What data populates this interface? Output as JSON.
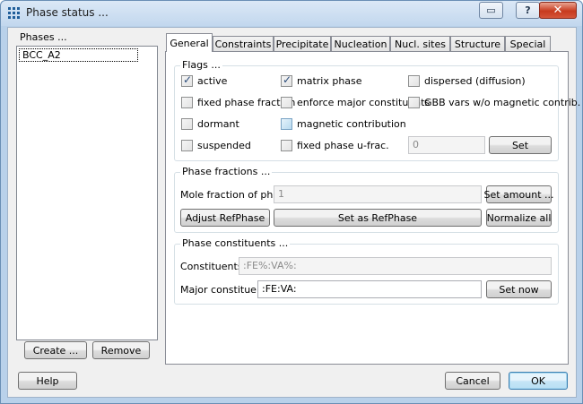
{
  "window": {
    "title": "Phase status ...",
    "help_glyph": "?",
    "close_glyph": "✕",
    "restore_glyph": "▭"
  },
  "phases": {
    "label": "Phases ...",
    "items": [
      "BCC_A2"
    ],
    "create_label": "Create ...",
    "remove_label": "Remove"
  },
  "tabs": [
    {
      "label": "General",
      "active": true
    },
    {
      "label": "Constraints",
      "active": false
    },
    {
      "label": "Precipitate",
      "active": false
    },
    {
      "label": "Nucleation",
      "active": false
    },
    {
      "label": "Nucl. sites",
      "active": false
    },
    {
      "label": "Structure",
      "active": false
    },
    {
      "label": "Special",
      "active": false
    }
  ],
  "flags": {
    "title": "Flags ...",
    "items": [
      {
        "label": "active",
        "checked": true
      },
      {
        "label": "matrix phase",
        "checked": true
      },
      {
        "label": "dispersed (diffusion)",
        "checked": false
      },
      {
        "label": "fixed phase fraction",
        "checked": false
      },
      {
        "label": "enforce major constituents",
        "checked": false
      },
      {
        "label": "GBB vars w/o magnetic contrib.",
        "checked": false
      },
      {
        "label": "dormant",
        "checked": false
      },
      {
        "label": "magnetic contribution",
        "checked": false
      },
      {
        "label": "suspended",
        "checked": false
      },
      {
        "label": "fixed phase u-frac.",
        "checked": false
      }
    ],
    "ufrac_value": "0",
    "set_label": "Set"
  },
  "phase_fractions": {
    "title": "Phase fractions ...",
    "mole_fraction_label": "Mole fraction of phase:",
    "mole_fraction_value": "1",
    "set_amount_label": "Set amount ...",
    "adjust_label": "Adjust RefPhase",
    "set_ref_label": "Set as RefPhase",
    "normalize_label": "Normalize all"
  },
  "constituents": {
    "title": "Phase constituents ...",
    "constituents_label": "Constituents:",
    "constituents_value": ":FE%:VA%:",
    "major_label": "Major constituents",
    "major_value": ":FE:VA:",
    "set_now_label": "Set now"
  },
  "footer": {
    "help_label": "Help",
    "cancel_label": "Cancel",
    "ok_label": "OK"
  },
  "colors": {
    "frame": "#b9d1ea",
    "dialog_bg": "#f0f0f0",
    "close_red": "#c73a1e"
  }
}
